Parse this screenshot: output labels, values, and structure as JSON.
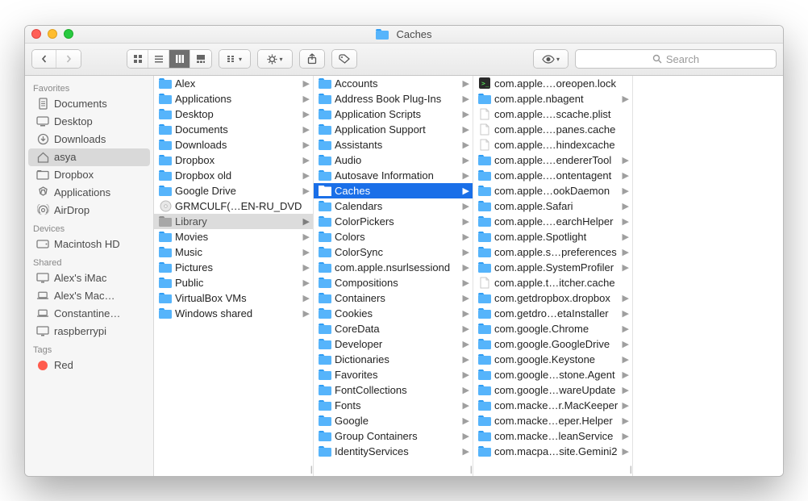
{
  "window": {
    "title": "Caches"
  },
  "toolbar": {
    "search_placeholder": "Search"
  },
  "sidebar": {
    "sections": [
      {
        "label": "Favorites",
        "items": [
          {
            "label": "Documents",
            "icon": "doc"
          },
          {
            "label": "Desktop",
            "icon": "desktop"
          },
          {
            "label": "Downloads",
            "icon": "download"
          },
          {
            "label": "asya",
            "icon": "home",
            "selected": true
          },
          {
            "label": "Dropbox",
            "icon": "folder"
          },
          {
            "label": "Applications",
            "icon": "apps"
          },
          {
            "label": "AirDrop",
            "icon": "airdrop"
          }
        ]
      },
      {
        "label": "Devices",
        "items": [
          {
            "label": "Macintosh HD",
            "icon": "hdd"
          }
        ]
      },
      {
        "label": "Shared",
        "items": [
          {
            "label": "Alex's iMac",
            "icon": "screen"
          },
          {
            "label": "Alex's Mac…",
            "icon": "laptop"
          },
          {
            "label": "Constantine…",
            "icon": "laptop"
          },
          {
            "label": "raspberrypi",
            "icon": "screen"
          }
        ]
      },
      {
        "label": "Tags",
        "items": [
          {
            "label": "Red",
            "icon": "tag",
            "color": "#ff5b4d"
          }
        ]
      }
    ]
  },
  "columns": [
    [
      {
        "label": "Alex",
        "type": "folder",
        "children": true
      },
      {
        "label": "Applications",
        "type": "folder",
        "children": true
      },
      {
        "label": "Desktop",
        "type": "folder",
        "children": true
      },
      {
        "label": "Documents",
        "type": "folder",
        "children": true
      },
      {
        "label": "Downloads",
        "type": "folder",
        "children": true
      },
      {
        "label": "Dropbox",
        "type": "folder",
        "children": true
      },
      {
        "label": "Dropbox old",
        "type": "folder",
        "children": true
      },
      {
        "label": "Google Drive",
        "type": "folder",
        "children": true
      },
      {
        "label": "GRMCULF(…EN-RU_DVD",
        "type": "disc",
        "children": false
      },
      {
        "label": "Library",
        "type": "folder",
        "children": true,
        "selected": "inactive"
      },
      {
        "label": "Movies",
        "type": "folder",
        "children": true
      },
      {
        "label": "Music",
        "type": "folder",
        "children": true
      },
      {
        "label": "Pictures",
        "type": "folder",
        "children": true
      },
      {
        "label": "Public",
        "type": "folder",
        "children": true
      },
      {
        "label": "VirtualBox VMs",
        "type": "folder",
        "children": true
      },
      {
        "label": "Windows shared",
        "type": "folder",
        "children": true
      }
    ],
    [
      {
        "label": "Accounts",
        "type": "folder",
        "children": true
      },
      {
        "label": "Address Book Plug-Ins",
        "type": "folder",
        "children": true
      },
      {
        "label": "Application Scripts",
        "type": "folder",
        "children": true
      },
      {
        "label": "Application Support",
        "type": "folder",
        "children": true
      },
      {
        "label": "Assistants",
        "type": "folder",
        "children": true
      },
      {
        "label": "Audio",
        "type": "folder",
        "children": true
      },
      {
        "label": "Autosave Information",
        "type": "folder",
        "children": true
      },
      {
        "label": "Caches",
        "type": "folder",
        "children": true,
        "selected": "active"
      },
      {
        "label": "Calendars",
        "type": "folder",
        "children": true
      },
      {
        "label": "ColorPickers",
        "type": "folder",
        "children": true
      },
      {
        "label": "Colors",
        "type": "folder",
        "children": true
      },
      {
        "label": "ColorSync",
        "type": "folder",
        "children": true
      },
      {
        "label": "com.apple.nsurlsessiond",
        "type": "folder",
        "children": true
      },
      {
        "label": "Compositions",
        "type": "folder",
        "children": true
      },
      {
        "label": "Containers",
        "type": "folder",
        "children": true
      },
      {
        "label": "Cookies",
        "type": "folder",
        "children": true
      },
      {
        "label": "CoreData",
        "type": "folder",
        "children": true
      },
      {
        "label": "Developer",
        "type": "folder",
        "children": true
      },
      {
        "label": "Dictionaries",
        "type": "folder",
        "children": true
      },
      {
        "label": "Favorites",
        "type": "folder",
        "children": true
      },
      {
        "label": "FontCollections",
        "type": "folder",
        "children": true
      },
      {
        "label": "Fonts",
        "type": "folder",
        "children": true
      },
      {
        "label": "Google",
        "type": "folder",
        "children": true
      },
      {
        "label": "Group Containers",
        "type": "folder",
        "children": true
      },
      {
        "label": "IdentityServices",
        "type": "folder",
        "children": true
      }
    ],
    [
      {
        "label": "com.apple.…oreopen.lock",
        "type": "exec",
        "children": false
      },
      {
        "label": "com.apple.nbagent",
        "type": "folder",
        "children": true
      },
      {
        "label": "com.apple.…scache.plist",
        "type": "file",
        "children": false
      },
      {
        "label": "com.apple.…panes.cache",
        "type": "file",
        "children": false
      },
      {
        "label": "com.apple.…hindexcache",
        "type": "file",
        "children": false
      },
      {
        "label": "com.apple.…endererTool",
        "type": "folder",
        "children": true
      },
      {
        "label": "com.apple.…ontentagent",
        "type": "folder",
        "children": true
      },
      {
        "label": "com.apple…ookDaemon",
        "type": "folder",
        "children": true
      },
      {
        "label": "com.apple.Safari",
        "type": "folder",
        "children": true
      },
      {
        "label": "com.apple.…earchHelper",
        "type": "folder",
        "children": true
      },
      {
        "label": "com.apple.Spotlight",
        "type": "folder",
        "children": true
      },
      {
        "label": "com.apple.s…preferences",
        "type": "folder",
        "children": true
      },
      {
        "label": "com.apple.SystemProfiler",
        "type": "folder",
        "children": true
      },
      {
        "label": "com.apple.t…itcher.cache",
        "type": "file",
        "children": false
      },
      {
        "label": "com.getdropbox.dropbox",
        "type": "folder",
        "children": true
      },
      {
        "label": "com.getdro…etaInstaller",
        "type": "folder",
        "children": true
      },
      {
        "label": "com.google.Chrome",
        "type": "folder",
        "children": true
      },
      {
        "label": "com.google.GoogleDrive",
        "type": "folder",
        "children": true
      },
      {
        "label": "com.google.Keystone",
        "type": "folder",
        "children": true
      },
      {
        "label": "com.google…stone.Agent",
        "type": "folder",
        "children": true
      },
      {
        "label": "com.google…wareUpdate",
        "type": "folder",
        "children": true
      },
      {
        "label": "com.macke…r.MacKeeper",
        "type": "folder",
        "children": true
      },
      {
        "label": "com.macke…eper.Helper",
        "type": "folder",
        "children": true
      },
      {
        "label": "com.macke…leanService",
        "type": "folder",
        "children": true
      },
      {
        "label": "com.macpa…site.Gemini2",
        "type": "folder",
        "children": true
      }
    ]
  ]
}
